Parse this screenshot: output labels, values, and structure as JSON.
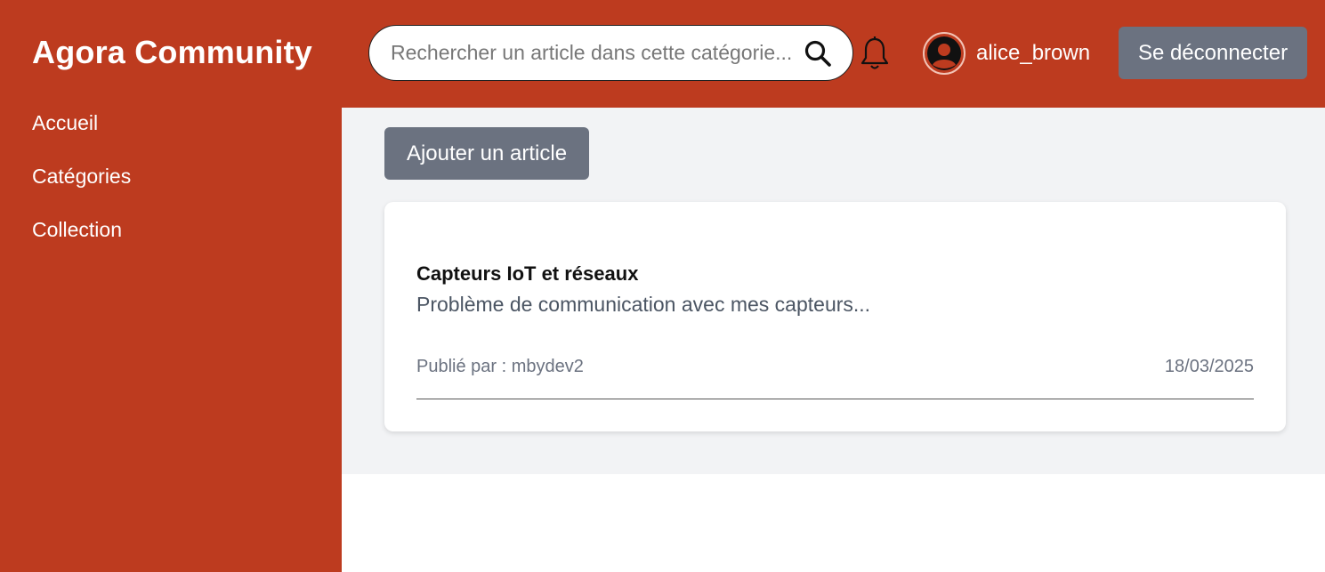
{
  "header": {
    "brand": "Agora Community",
    "search_placeholder": "Rechercher un article dans cette catégorie...",
    "username": "alice_brown",
    "logout_label": "Se déconnecter"
  },
  "sidebar": {
    "items": [
      {
        "label": "Accueil"
      },
      {
        "label": "Catégories"
      },
      {
        "label": "Collection"
      }
    ]
  },
  "main": {
    "add_article_label": "Ajouter un article",
    "articles": [
      {
        "title": "Capteurs IoT et réseaux",
        "excerpt": "Problème de communication avec mes capteurs...",
        "author_line": "Publié par : mbydev2",
        "date": "18/03/2025"
      }
    ]
  },
  "colors": {
    "brand_red": "#bd3b1f",
    "button_gray": "#6b7280",
    "content_bg": "#f2f3f5"
  },
  "icons": [
    "search-icon",
    "bell-icon",
    "user-avatar-icon"
  ]
}
